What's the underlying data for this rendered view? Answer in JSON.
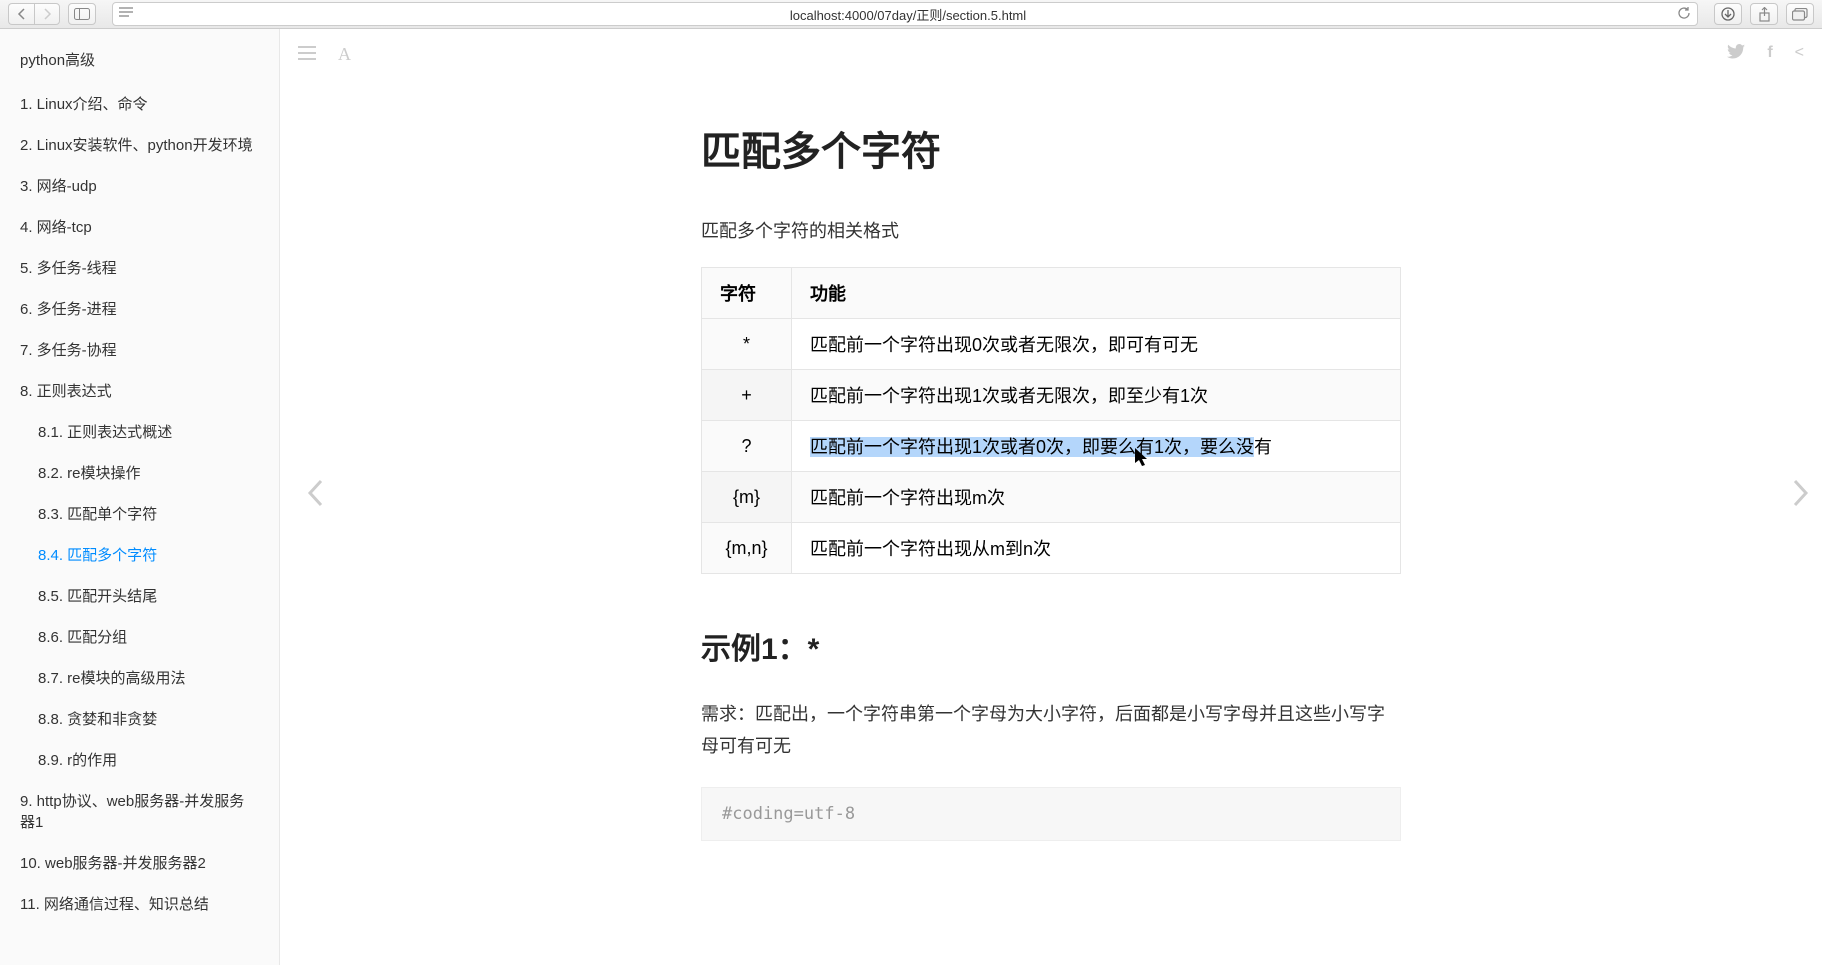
{
  "url": "localhost:4000/07day/正则/section.5.html",
  "book_title": "python高级",
  "sidebar": [
    {
      "label": "1. Linux介绍、命令",
      "sub": false,
      "active": false
    },
    {
      "label": "2. Linux安装软件、python开发环境",
      "sub": false,
      "active": false
    },
    {
      "label": "3. 网络-udp",
      "sub": false,
      "active": false
    },
    {
      "label": "4. 网络-tcp",
      "sub": false,
      "active": false
    },
    {
      "label": "5. 多任务-线程",
      "sub": false,
      "active": false
    },
    {
      "label": "6. 多任务-进程",
      "sub": false,
      "active": false
    },
    {
      "label": "7. 多任务-协程",
      "sub": false,
      "active": false
    },
    {
      "label": "8. 正则表达式",
      "sub": false,
      "active": false
    },
    {
      "label": "8.1. 正则表达式概述",
      "sub": true,
      "active": false
    },
    {
      "label": "8.2. re模块操作",
      "sub": true,
      "active": false
    },
    {
      "label": "8.3. 匹配单个字符",
      "sub": true,
      "active": false
    },
    {
      "label": "8.4. 匹配多个字符",
      "sub": true,
      "active": true
    },
    {
      "label": "8.5. 匹配开头结尾",
      "sub": true,
      "active": false
    },
    {
      "label": "8.6. 匹配分组",
      "sub": true,
      "active": false
    },
    {
      "label": "8.7. re模块的高级用法",
      "sub": true,
      "active": false
    },
    {
      "label": "8.8. 贪婪和非贪婪",
      "sub": true,
      "active": false
    },
    {
      "label": "8.9. r的作用",
      "sub": true,
      "active": false
    },
    {
      "label": "9. http协议、web服务器-并发服务器1",
      "sub": false,
      "active": false
    },
    {
      "label": "10. web服务器-并发服务器2",
      "sub": false,
      "active": false
    },
    {
      "label": "11. 网络通信过程、知识总结",
      "sub": false,
      "active": false
    }
  ],
  "page": {
    "h1": "匹配多个字符",
    "desc": "匹配多个字符的相关格式",
    "th_char": "字符",
    "th_func": "功能",
    "rows": [
      {
        "char": "*",
        "func": "匹配前一个字符出现0次或者无限次，即可有可无",
        "hl": false
      },
      {
        "char": "+",
        "func": "匹配前一个字符出现1次或者无限次，即至少有1次",
        "hl": false
      },
      {
        "char": "?",
        "func_pre": "匹配前一个字符出现1次或者0次，即要么有1次，要么没",
        "func_post": "有",
        "hl": true
      },
      {
        "char": "{m}",
        "func": "匹配前一个字符出现m次",
        "hl": false
      },
      {
        "char": "{m,n}",
        "func": "匹配前一个字符出现从m到n次",
        "hl": false
      }
    ],
    "h2": "示例1：*",
    "para": "需求：匹配出，一个字符串第一个字母为大小字符，后面都是小写字母并且这些小写字母可有可无",
    "code": "#coding=utf-8"
  }
}
